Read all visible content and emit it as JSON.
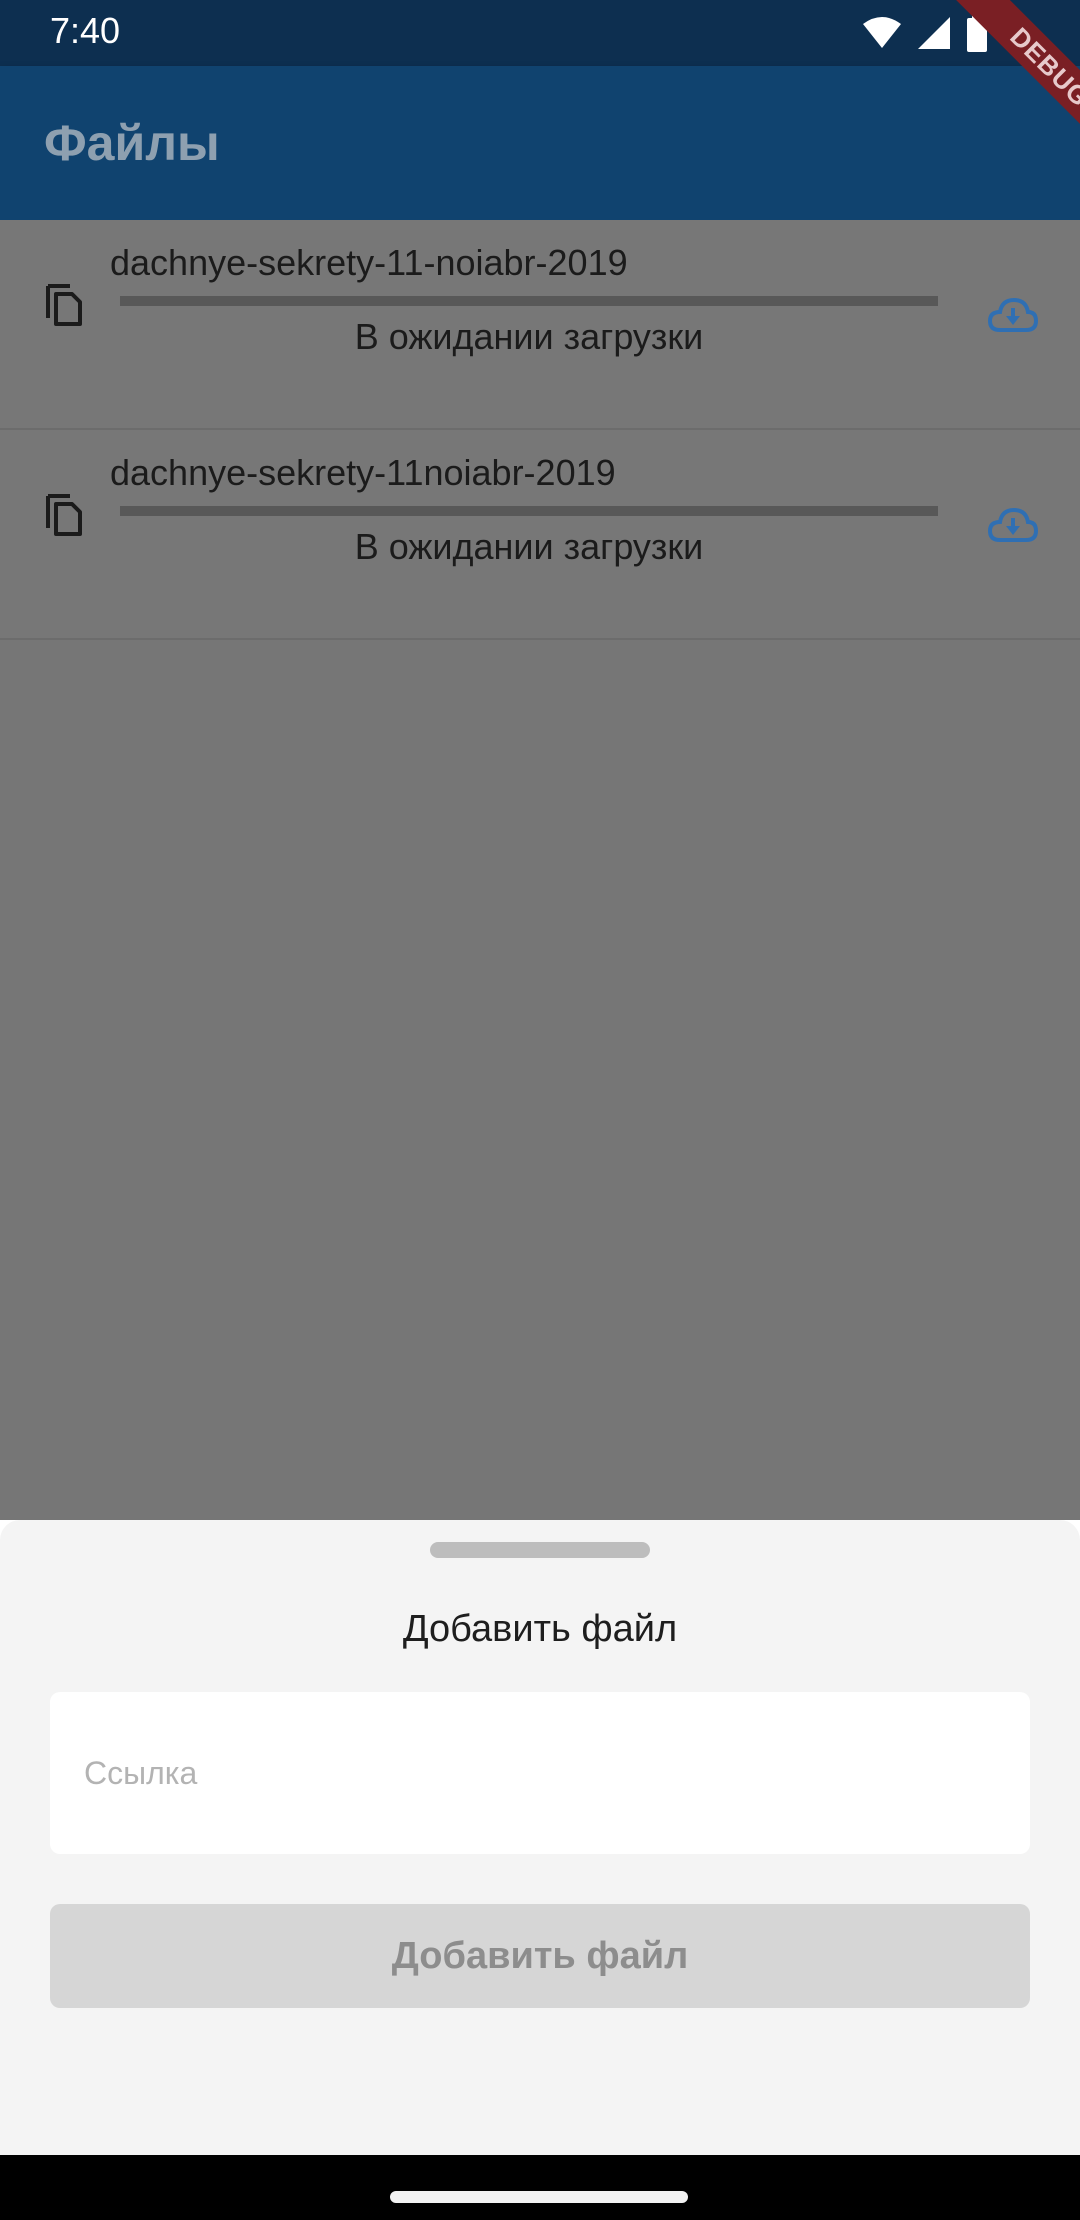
{
  "status_bar": {
    "time": "7:40"
  },
  "app_bar": {
    "title": "Файлы",
    "debug_label": "DEBUG"
  },
  "files": [
    {
      "name": "dachnye-sekrety-11-noiabr-2019",
      "status": "В ожидании загрузки",
      "progress": 0
    },
    {
      "name": "dachnye-sekrety-11noiabr-2019",
      "status": "В ожидании загрузки",
      "progress": 0
    }
  ],
  "sheet": {
    "title": "Добавить файл",
    "link_placeholder": "Ссылка",
    "link_value": "",
    "add_button_label": "Добавить файл"
  },
  "colors": {
    "app_bar": "#10436f",
    "accent": "#2f6fb3",
    "debug_banner": "#7a1f24"
  }
}
